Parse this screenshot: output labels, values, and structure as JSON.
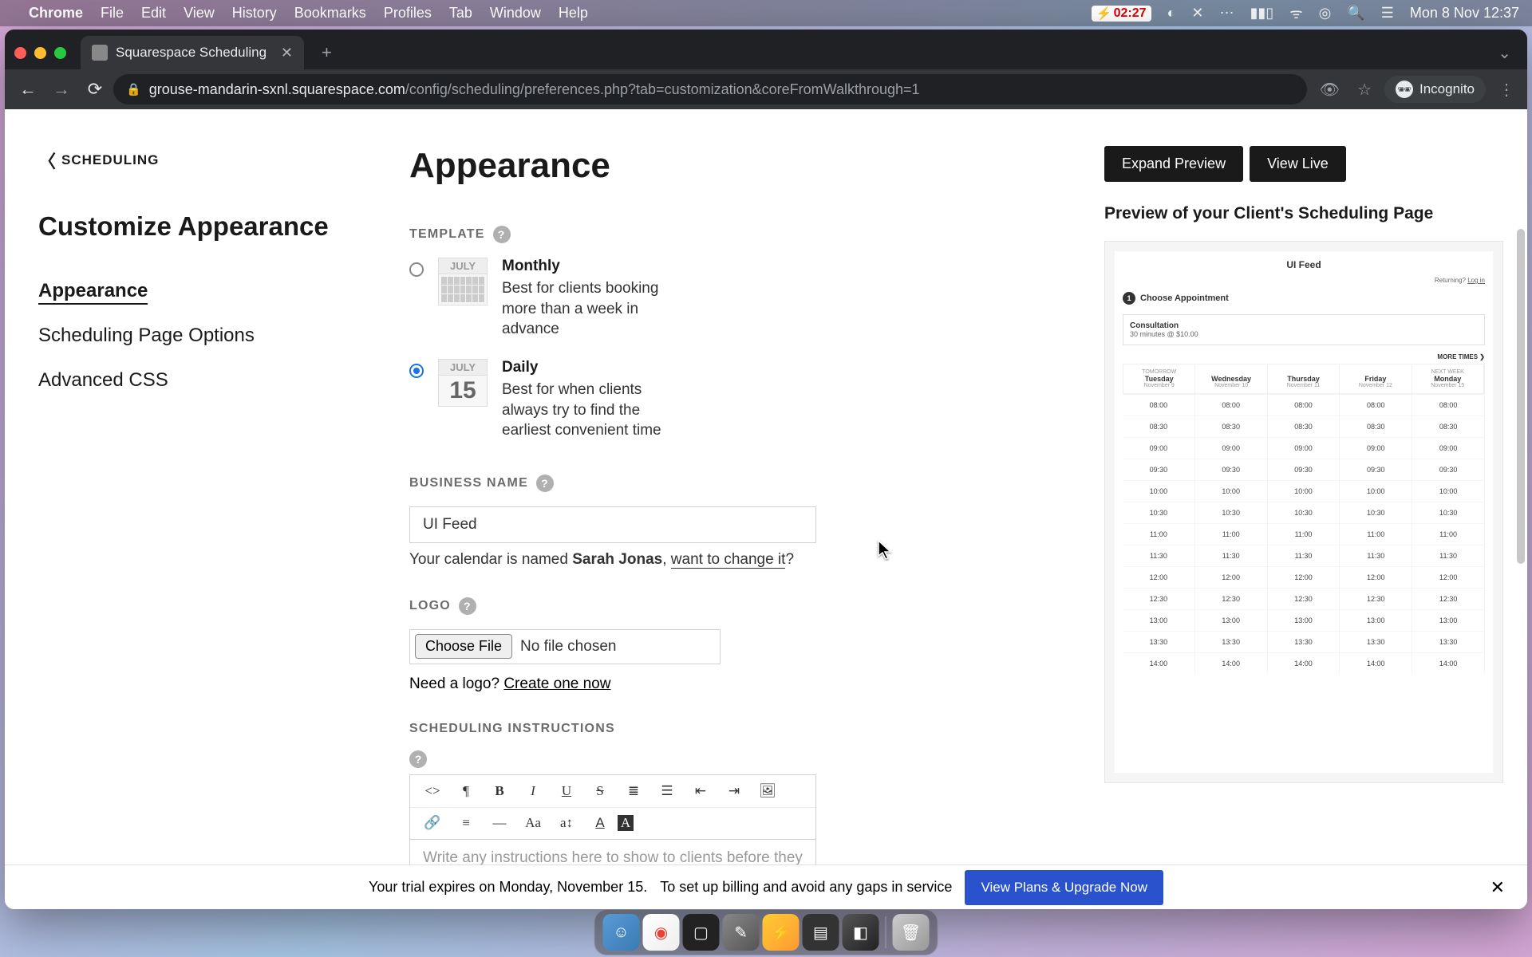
{
  "menubar": {
    "app": "Chrome",
    "items": [
      "File",
      "Edit",
      "View",
      "History",
      "Bookmarks",
      "Profiles",
      "Tab",
      "Window",
      "Help"
    ],
    "timer": "02:27",
    "datetime": "Mon 8 Nov  12:37"
  },
  "browser": {
    "tab_title": "Squarespace Scheduling",
    "url_host": "grouse-mandarin-sxnl.squarespace.com",
    "url_path": "/config/scheduling/preferences.php?tab=customization&coreFromWalkthrough=1",
    "incognito": "Incognito"
  },
  "sidebar": {
    "back": "SCHEDULING",
    "title": "Customize Appearance",
    "nav": [
      "Appearance",
      "Scheduling Page Options",
      "Advanced CSS"
    ]
  },
  "main": {
    "title": "Appearance",
    "template_label": "TEMPLATE",
    "templates": {
      "monthly": {
        "icon_month": "JULY",
        "title": "Monthly",
        "desc": "Best for clients booking more than a week in advance"
      },
      "daily": {
        "icon_month": "JULY",
        "icon_day": "15",
        "title": "Daily",
        "desc": "Best for when clients always try to find the earliest convenient time"
      }
    },
    "business_name_label": "BUSINESS NAME",
    "business_name_value": "UI Feed",
    "calendar_prefix": "Your calendar is named ",
    "calendar_name": "Sarah Jonas",
    "calendar_sep": ", ",
    "calendar_link": "want to change it",
    "calendar_q": "?",
    "logo_label": "LOGO",
    "choose_file": "Choose File",
    "no_file": "No file chosen",
    "need_logo": "Need a logo? ",
    "create_one": "Create one now",
    "instructions_label": "SCHEDULING INSTRUCTIONS",
    "instructions_placeholder": "Write any instructions here to show to clients before they"
  },
  "preview": {
    "expand": "Expand Preview",
    "view_live": "View Live",
    "heading": "Preview of your Client's Scheduling Page",
    "frame": {
      "title": "UI Feed",
      "returning": "Returning? ",
      "login": "Log in",
      "step_num": "1",
      "step_label": "Choose Appointment",
      "card_title": "Consultation",
      "card_detail": "30 minutes @ $10.00",
      "more_times": "MORE TIMES ❯",
      "days": [
        {
          "sup": "TOMORROW",
          "name": "Tuesday",
          "date": "November 9"
        },
        {
          "sup": "",
          "name": "Wednesday",
          "date": "November 10"
        },
        {
          "sup": "",
          "name": "Thursday",
          "date": "November 11"
        },
        {
          "sup": "",
          "name": "Friday",
          "date": "November 12"
        },
        {
          "sup": "NEXT WEEK",
          "name": "Monday",
          "date": "November 15"
        }
      ],
      "slots": [
        "08:00",
        "08:30",
        "09:00",
        "09:30",
        "10:00",
        "10:30",
        "11:00",
        "11:30",
        "12:00",
        "12:30",
        "13:00",
        "13:30",
        "14:00"
      ]
    }
  },
  "banner": {
    "text1": "Your trial expires on Monday, November 15.",
    "text2": "To set up billing and avoid any gaps in service",
    "cta": "View Plans & Upgrade Now"
  }
}
